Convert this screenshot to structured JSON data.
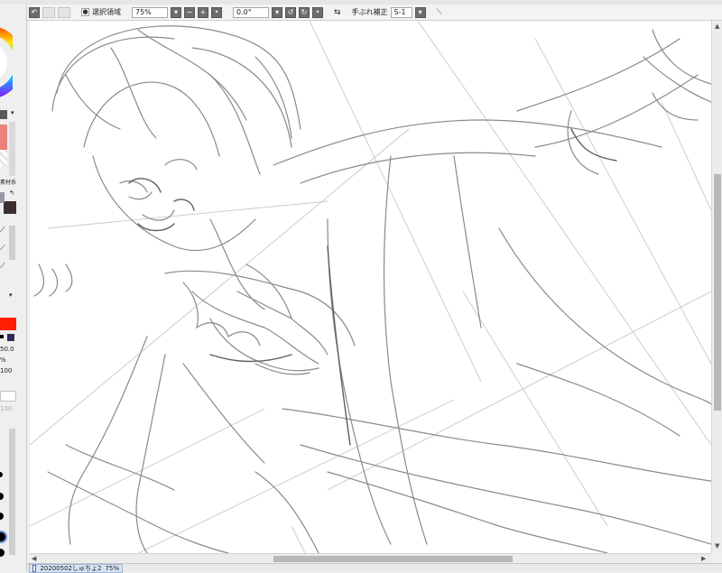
{
  "toolbar": {
    "selection_label": "選択領域",
    "zoom_value": "75%",
    "rotation_value": "0.0°",
    "stabilizer_label": "手ぶれ補正",
    "stabilizer_value": "S-1"
  },
  "left_panel": {
    "material_label": "素材系",
    "size_value": "50.0",
    "percent_symbol": "%",
    "density_value": "100",
    "density_value_2": "100",
    "colors": {
      "gray_swatch": "#5a5a5a",
      "salmon_swatch": "#e9827a",
      "dark_swatch": "#3a2e2e",
      "red_swatch": "#ff1e00"
    }
  },
  "status": {
    "document_name": "20200502しゅちょ2",
    "document_zoom": "75%"
  },
  "icons": {
    "undo": "undo-icon",
    "redo": "redo-icon",
    "check": "check-icon",
    "stabilizer": "pen-icon"
  }
}
